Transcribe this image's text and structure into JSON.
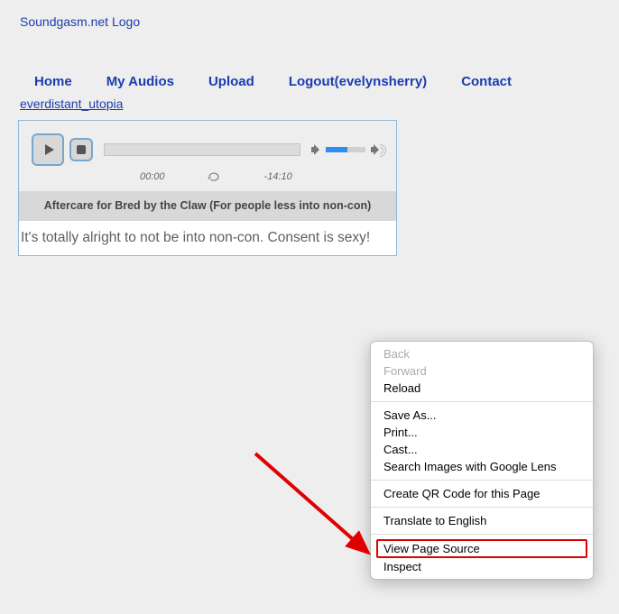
{
  "logo_text": "Soundgasm.net Logo",
  "nav": {
    "home": "Home",
    "my_audios": "My Audios",
    "upload": "Upload",
    "logout": "Logout(evelynsherry)",
    "contact": "Contact"
  },
  "username_link": "everdistant_utopia",
  "player": {
    "current_time": "00:00",
    "remaining_time": "-14:10",
    "title": "Aftercare for Bred by the Claw (For people less into non-con)",
    "description": "It's totally alright to not be into non-con. Consent is sexy!"
  },
  "context_menu": {
    "back": "Back",
    "forward": "Forward",
    "reload": "Reload",
    "save_as": "Save As...",
    "print": "Print...",
    "cast": "Cast...",
    "search_images": "Search Images with Google Lens",
    "create_qr": "Create QR Code for this Page",
    "translate": "Translate to English",
    "view_source": "View Page Source",
    "inspect": "Inspect"
  }
}
